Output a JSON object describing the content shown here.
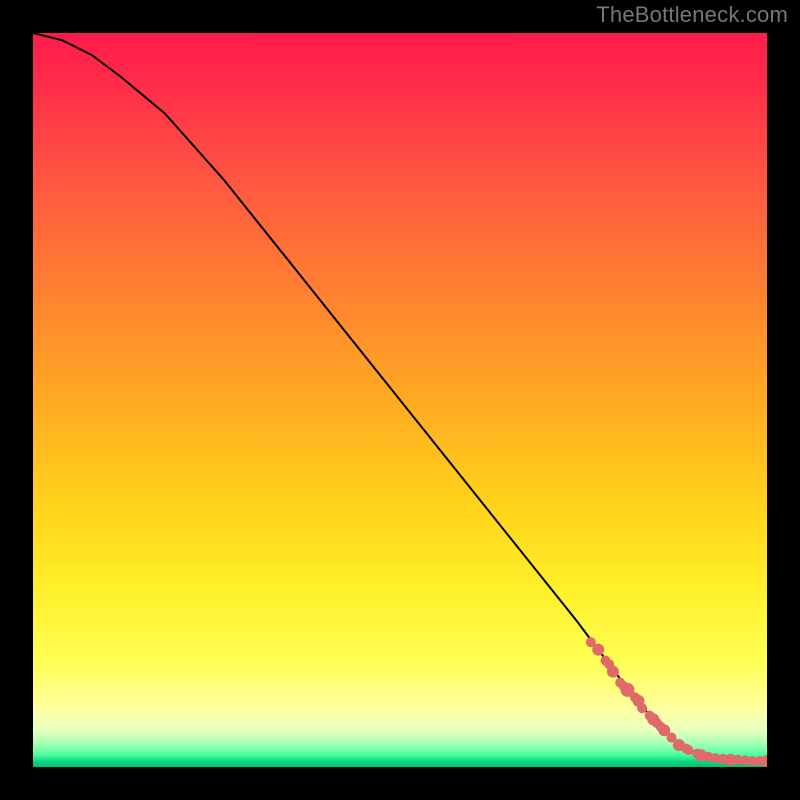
{
  "attribution": "TheBottleneck.com",
  "chart_data": {
    "type": "line",
    "title": "",
    "xlabel": "",
    "ylabel": "",
    "xlim": [
      0,
      100
    ],
    "ylim": [
      0,
      100
    ],
    "series": [
      {
        "name": "guide-curve",
        "x": [
          0,
          4,
          8,
          12,
          18,
          26,
          34,
          42,
          50,
          58,
          66,
          74,
          80,
          84,
          87,
          89,
          91,
          93,
          95,
          97,
          99,
          100
        ],
        "y": [
          100,
          99,
          97,
          94,
          89,
          80,
          70,
          60,
          50,
          40,
          30,
          20,
          12,
          7,
          4,
          2.5,
          1.8,
          1.3,
          1.0,
          0.8,
          0.7,
          0.7
        ]
      }
    ],
    "scatter": [
      {
        "name": "cluster-points",
        "x": [
          76,
          77,
          78,
          78.5,
          79,
          80,
          80.5,
          81,
          82,
          82.5,
          83,
          84,
          84.5,
          85,
          85.5,
          86,
          87,
          88,
          89,
          89.3,
          90.5,
          91,
          92,
          93,
          94,
          95,
          96,
          97,
          98,
          99,
          100
        ],
        "y": [
          17,
          16,
          14.5,
          14,
          13,
          11.5,
          11,
          10.5,
          9.5,
          9,
          8,
          7,
          6.5,
          6,
          5.5,
          5,
          4,
          3,
          2.5,
          2.3,
          1.8,
          1.6,
          1.4,
          1.2,
          1.1,
          1.0,
          1.0,
          0.9,
          0.8,
          0.8,
          0.8
        ],
        "r": [
          5,
          6,
          5,
          5,
          6,
          5,
          5,
          7,
          5,
          6,
          5,
          5,
          6,
          5,
          5,
          6,
          5,
          6,
          5,
          5,
          5,
          6,
          5,
          5,
          5,
          6,
          5,
          5,
          5,
          5,
          6
        ]
      }
    ]
  }
}
